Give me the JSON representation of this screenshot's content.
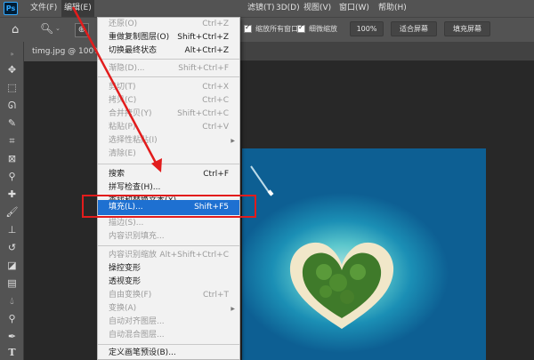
{
  "menubar": {
    "logo": "Ps",
    "items": [
      {
        "label": "文件(F)"
      },
      {
        "label": "编辑(E)"
      },
      {
        "label": "滤镜(T)"
      },
      {
        "label": "3D(D)"
      },
      {
        "label": "视图(V)"
      },
      {
        "label": "窗口(W)"
      },
      {
        "label": "帮助(H)"
      }
    ]
  },
  "options_bar": {
    "checkbox_all_windows": "缩放所有窗口",
    "checkbox_scrubby": "细微缩放",
    "zoom_value": "100%",
    "fit_screen": "适合屏幕",
    "fill_screen": "填充屏幕"
  },
  "document_tab": {
    "label": "timg.jpg @ 100%(R"
  },
  "edit_menu": {
    "items": [
      {
        "label": "还原(O)",
        "shortcut": "Ctrl+Z",
        "state": "disabled"
      },
      {
        "label": "重做复制图层(O)",
        "shortcut": "Shift+Ctrl+Z",
        "state": "enabled"
      },
      {
        "label": "切换最终状态",
        "shortcut": "Alt+Ctrl+Z",
        "state": "enabled"
      },
      {
        "label": "渐隐(D)...",
        "shortcut": "Shift+Ctrl+F",
        "state": "disabled"
      },
      {
        "label": "剪切(T)",
        "shortcut": "Ctrl+X",
        "state": "disabled"
      },
      {
        "label": "拷贝(C)",
        "shortcut": "Ctrl+C",
        "state": "disabled"
      },
      {
        "label": "合并拷贝(Y)",
        "shortcut": "Shift+Ctrl+C",
        "state": "disabled"
      },
      {
        "label": "粘贴(P)",
        "shortcut": "Ctrl+V",
        "state": "disabled"
      },
      {
        "label": "选择性粘贴(I)",
        "shortcut": "",
        "state": "disabled",
        "submenu": true
      },
      {
        "label": "清除(E)",
        "shortcut": "",
        "state": "disabled"
      },
      {
        "label": "搜索",
        "shortcut": "Ctrl+F",
        "state": "enabled"
      },
      {
        "label": "拼写检查(H)...",
        "shortcut": "",
        "state": "enabled"
      },
      {
        "label": "查找和替换文本(X)...",
        "shortcut": "",
        "state": "enabled"
      },
      {
        "label": "填充(L)...",
        "shortcut": "Shift+F5",
        "state": "highlighted"
      },
      {
        "label": "描边(S)...",
        "shortcut": "",
        "state": "disabled"
      },
      {
        "label": "内容识别填充...",
        "shortcut": "",
        "state": "disabled"
      },
      {
        "label": "内容识别缩放",
        "shortcut": "Alt+Shift+Ctrl+C",
        "state": "disabled"
      },
      {
        "label": "操控变形",
        "shortcut": "",
        "state": "enabled"
      },
      {
        "label": "透视变形",
        "shortcut": "",
        "state": "enabled"
      },
      {
        "label": "自由变换(F)",
        "shortcut": "Ctrl+T",
        "state": "disabled"
      },
      {
        "label": "变换(A)",
        "shortcut": "",
        "state": "disabled",
        "submenu": true
      },
      {
        "label": "自动对齐图层...",
        "shortcut": "",
        "state": "disabled"
      },
      {
        "label": "自动混合图层...",
        "shortcut": "",
        "state": "disabled"
      },
      {
        "label": "定义画笔预设(B)...",
        "shortcut": "",
        "state": "enabled"
      }
    ]
  },
  "colors": {
    "highlight": "#1e70d1",
    "annotation_red": "#e21c1c",
    "ui_panel": "#535353"
  }
}
